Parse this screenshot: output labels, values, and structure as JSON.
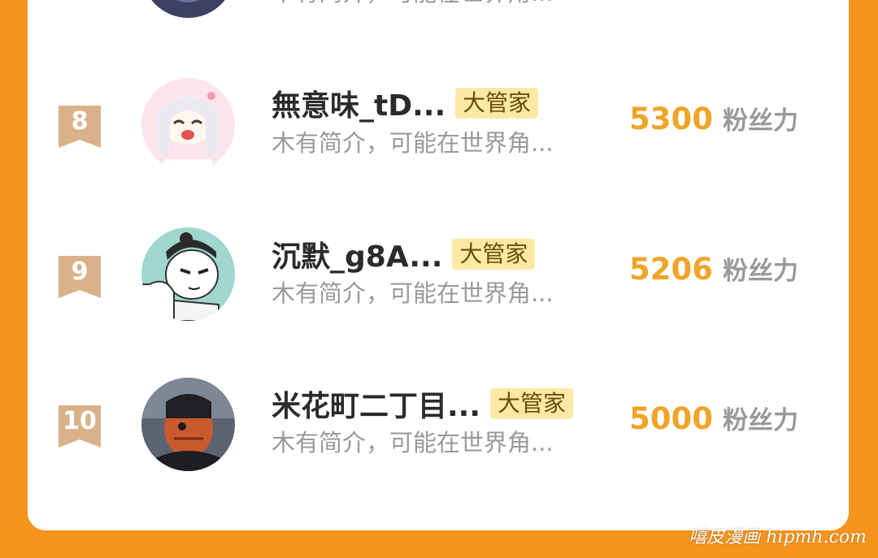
{
  "ranking": {
    "partial_row": {
      "bio": "木有简介，可能在世界角..."
    },
    "rows": [
      {
        "rank": "8",
        "name": "無意味_tD...",
        "badge": "大管家",
        "bio": "木有简介，可能在世界角...",
        "score": "5300",
        "score_unit": "粉丝力"
      },
      {
        "rank": "9",
        "name": "沉默_g8A...",
        "badge": "大管家",
        "bio": "木有简介，可能在世界角...",
        "score": "5206",
        "score_unit": "粉丝力"
      },
      {
        "rank": "10",
        "name": "米花町二丁目...",
        "badge": "大管家",
        "bio": "木有简介，可能在世界角...",
        "score": "5000",
        "score_unit": "粉丝力"
      }
    ]
  },
  "colors": {
    "background": "#f7941e",
    "panel": "#ffffff",
    "score": "#f0a428",
    "rank_ribbon": "#d9b28a",
    "badge_bg": "#fde9a6"
  },
  "watermark": "嘻皮漫画 hipmh.com"
}
